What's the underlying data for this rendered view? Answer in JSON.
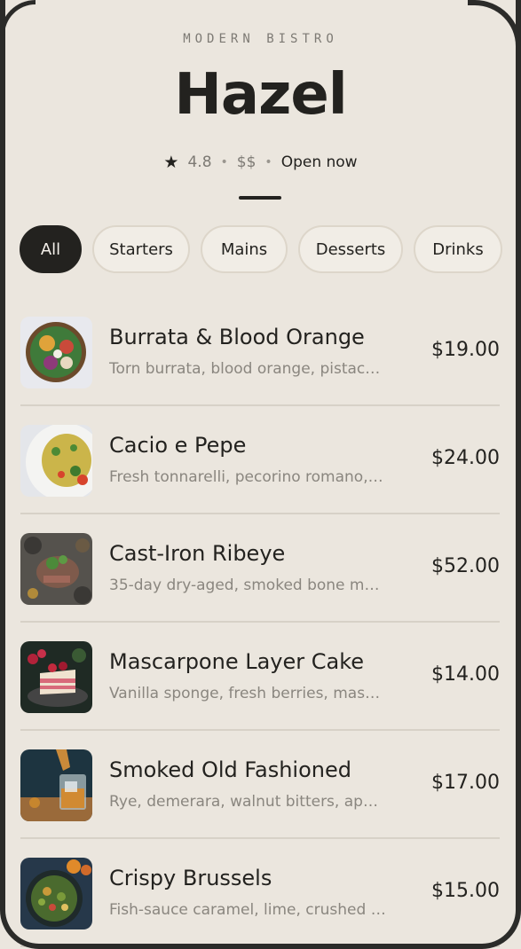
{
  "header": {
    "kicker": "MODERN BISTRO",
    "title": "Hazel",
    "rating": "4.8",
    "price_level": "$$",
    "status": "Open now",
    "star_icon": "star-icon"
  },
  "tabs": [
    {
      "label": "All",
      "active": true
    },
    {
      "label": "Starters",
      "active": false
    },
    {
      "label": "Mains",
      "active": false
    },
    {
      "label": "Desserts",
      "active": false
    },
    {
      "label": "Drinks",
      "active": false
    }
  ],
  "menu": [
    {
      "name": "Burrata & Blood Orange",
      "description": "Torn burrata, blood orange, pistachio...",
      "price": "$19.00"
    },
    {
      "name": "Cacio e Pepe",
      "description": "Fresh tonnarelli, pecorino romano, c...",
      "price": "$24.00"
    },
    {
      "name": "Cast-Iron Ribeye",
      "description": "35-day dry-aged, smoked bone marr...",
      "price": "$52.00"
    },
    {
      "name": "Mascarpone Layer Cake",
      "description": "Vanilla sponge, fresh berries, mascar...",
      "price": "$14.00"
    },
    {
      "name": "Smoked Old Fashioned",
      "description": "Rye, demerara, walnut bitters, applew...",
      "price": "$17.00"
    },
    {
      "name": "Crispy Brussels",
      "description": "Fish-sauce caramel, lime, crushed pe...",
      "price": "$15.00"
    }
  ],
  "colors": {
    "background": "#ebe6de",
    "text": "#23221f",
    "muted": "#8a867f",
    "chip_active": "#23221f",
    "chip_bg": "#f1ede6"
  }
}
